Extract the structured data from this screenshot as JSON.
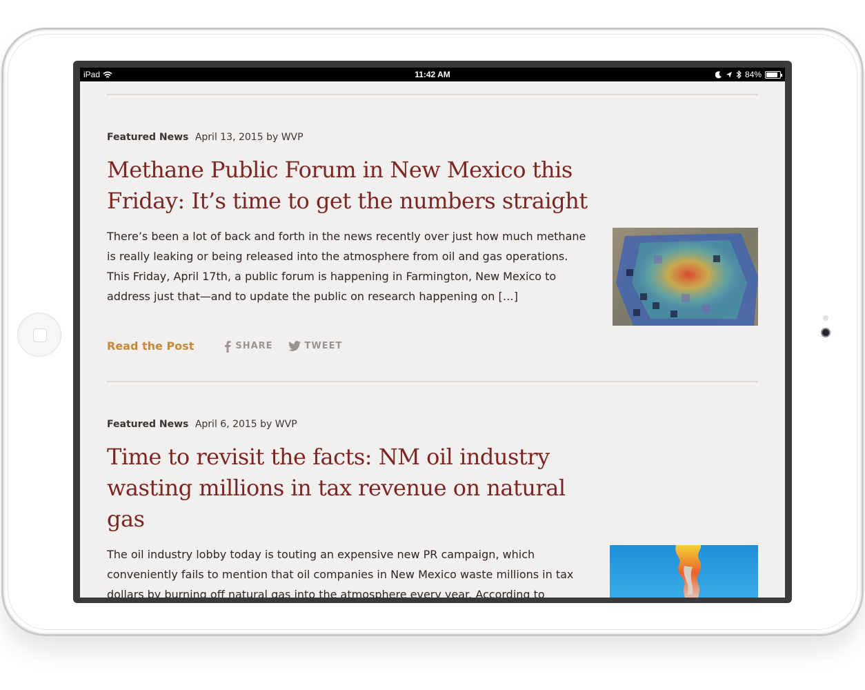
{
  "status_bar": {
    "device": "iPad",
    "time": "11:42 AM",
    "battery": "84%"
  },
  "posts": [
    {
      "category": "Featured News",
      "date_author": "April 13, 2015 by WVP",
      "title": "Methane Public Forum in New Mexico this Friday: It’s time to get the numbers straight",
      "excerpt": "There’s been a lot of back and forth in the news recently over just how much methane is really leaking or being released into the atmosphere from oil and gas operations. This Friday, April 17th, a public forum is happening in Farmington, New Mexico to address just that—and to update the public on research happening on […]",
      "read_label": "Read the Post",
      "share_label": "SHARE",
      "tweet_label": "TWEET"
    },
    {
      "category": "Featured News",
      "date_author": "April 6, 2015 by WVP",
      "title": "Time to revisit the facts: NM oil industry wasting millions in tax revenue on natural gas",
      "excerpt": "The oil industry lobby today is touting an expensive new PR campaign, which conveniently fails to mention that oil companies in New Mexico waste millions in tax dollars by burning off natural gas into the atmosphere every year. According to"
    }
  ],
  "colors": {
    "title": "#7b2622",
    "link": "#c48a3a",
    "background": "#f2f0ee"
  },
  "icons": [
    "wifi-icon",
    "moon-icon",
    "location-arrow-icon",
    "bluetooth-icon",
    "battery-icon",
    "facebook-icon",
    "twitter-icon"
  ]
}
